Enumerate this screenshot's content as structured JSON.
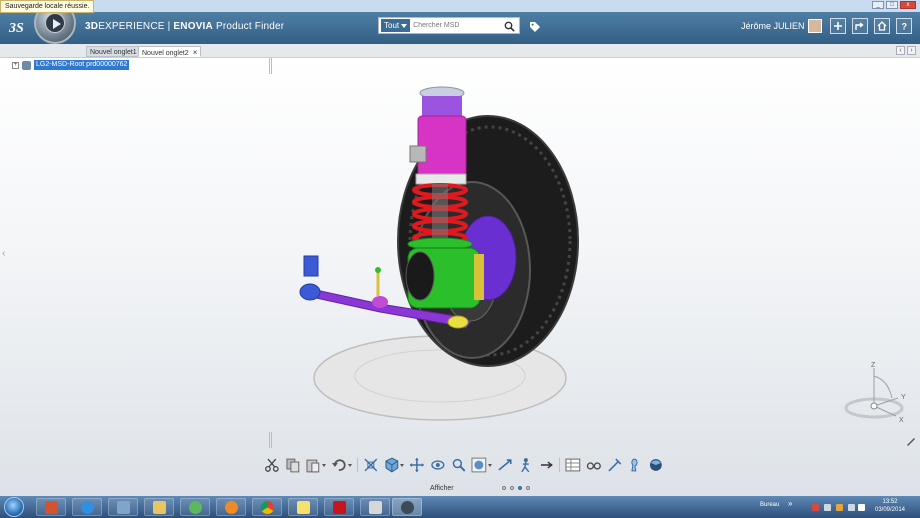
{
  "notification": {
    "text": "Sauvegarde locale réussie."
  },
  "header": {
    "brand_prefix": "3D",
    "brand_rest": "EXPERIENCE",
    "separator": " | ",
    "app_brand": "ENOVIA",
    "app_name": " Product Finder",
    "user_name": "Jérôme JULIEN"
  },
  "search": {
    "scope_label": "Tout",
    "placeholder": "Chercher MSD"
  },
  "tabs": [
    {
      "label": "Nouvel onglet1",
      "active": false
    },
    {
      "label": "Nouvel onglet2",
      "active": true,
      "close": "×"
    }
  ],
  "tree": {
    "root_label": "LG2-MSD-Root prd00000762",
    "expander": "+"
  },
  "gizmo": {
    "z": "Z",
    "y": "Y",
    "x": "X"
  },
  "toolbar": {
    "section_label": "Afficher",
    "icons": [
      "cut-icon",
      "copy-icon",
      "paste-icon",
      "undo-icon",
      "fit-all-icon",
      "cube-view-icon",
      "pan-icon",
      "rotate-icon",
      "zoom-icon",
      "render-style-icon",
      "fly-icon",
      "walk-icon",
      "table-icon",
      "glasses-icon",
      "measure-icon",
      "ruler-icon",
      "explode-icon",
      "color-icon"
    ],
    "page_count": 4,
    "active_page": 2
  },
  "taskbar": {
    "tray_label": "Bureau",
    "tray_chevron": "»",
    "time": "13:52",
    "date": "03/09/2014",
    "apps": [
      "powerpoint-icon",
      "internet-explorer-icon",
      "network-icon",
      "folder-icon",
      "messenger-icon",
      "media-icon",
      "chrome-icon",
      "sticky-notes-icon",
      "acrobat-icon",
      "paint-icon",
      "3dexperience-icon"
    ]
  },
  "colors": {
    "header_top": "#4f7fa5",
    "header_bottom": "#335f84",
    "selection": "#2f78d2",
    "spring_red": "#e0191f",
    "mount_magenta": "#d72ec8",
    "arm_purple": "#8b37d6",
    "hub_green": "#2bbf2b"
  }
}
